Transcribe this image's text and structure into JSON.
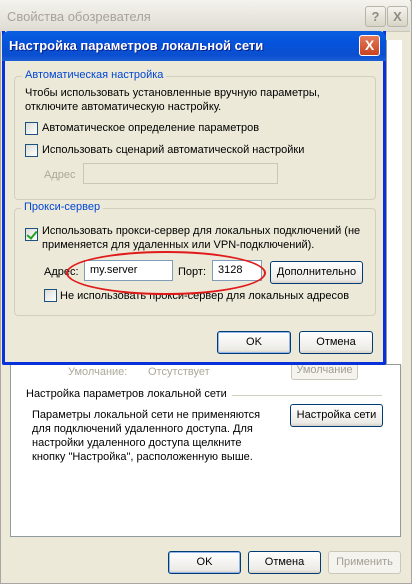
{
  "outer_window": {
    "title": "Свойства обозревателя",
    "help_button": "?",
    "close_button": "X",
    "default_label": "Умолчание:",
    "default_value": "Отсутствует",
    "default_button": "Умолчание",
    "lan_section_title": "Настройка параметров локальной сети",
    "lan_section_text": "Параметры локальной сети не применяются для подключений удаленного доступа. Для настройки удаленного доступа щелкните кнопку \"Настройка\", расположенную выше.",
    "lan_settings_button": "Настройка сети",
    "ok_button": "OK",
    "cancel_button": "Отмена",
    "apply_button": "Применить"
  },
  "dialog": {
    "title": "Настройка параметров локальной сети",
    "close_button": "X",
    "auto_config": {
      "legend": "Автоматическая настройка",
      "description": "Чтобы использовать установленные вручную параметры, отключите автоматическую настройку.",
      "auto_detect_label": "Автоматическое определение параметров",
      "auto_detect_checked": false,
      "use_script_label": "Использовать сценарий автоматической настройки",
      "use_script_checked": false,
      "address_label": "Адрес",
      "address_value": ""
    },
    "proxy": {
      "legend": "Прокси-сервер",
      "use_proxy_label": "Использовать прокси-сервер для локальных подключений (не применяется для удаленных или VPN-подключений).",
      "use_proxy_checked": true,
      "address_label": "Адрес:",
      "address_value": "my.server",
      "port_label": "Порт:",
      "port_value": "3128",
      "advanced_button": "Дополнительно",
      "bypass_local_label": "Не использовать прокси-сервер для локальных адресов",
      "bypass_local_checked": false
    },
    "ok_button": "OK",
    "cancel_button": "Отмена"
  },
  "colors": {
    "dialog_titlebar": "#0553dc",
    "group_legend": "#0046d5",
    "annotation_ellipse": "#e01a1a"
  }
}
